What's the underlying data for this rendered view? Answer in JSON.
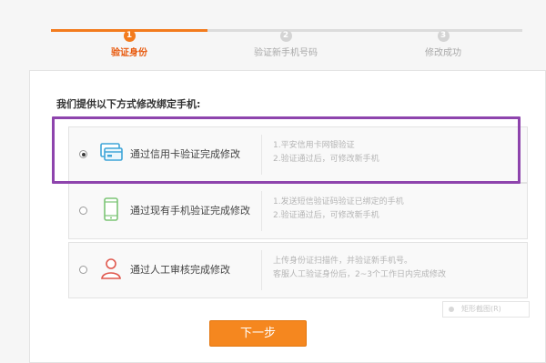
{
  "stepper": {
    "steps": [
      {
        "num": "1",
        "label": "验证身份"
      },
      {
        "num": "2",
        "label": "验证新手机号码"
      },
      {
        "num": "3",
        "label": "修改成功"
      }
    ],
    "active_color": "#f37b1d"
  },
  "intro": "我们提供以下方式修改绑定手机:",
  "options": [
    {
      "title": "通过信用卡验证完成修改",
      "icon": "credit-card-icon",
      "selected": true,
      "desc": [
        "1.平安信用卡网银验证",
        "2.验证通过后，可修改新手机"
      ]
    },
    {
      "title": "通过现有手机验证完成修改",
      "icon": "mobile-phone-icon",
      "selected": false,
      "desc": [
        "1.发送短信验证码验证已绑定的手机",
        "2.验证通过后，可修改新手机"
      ]
    },
    {
      "title": "通过人工审核完成修改",
      "icon": "person-icon",
      "selected": false,
      "desc": [
        "上传身份证扫描件，并验证新手机号。",
        "客服人工验证身份后，2~3个工作日内完成修改"
      ]
    }
  ],
  "watermark": "矩形截图(R)",
  "next_button": "下一步",
  "colors": {
    "highlight": "#8e44ad",
    "button": "#f5871f"
  }
}
